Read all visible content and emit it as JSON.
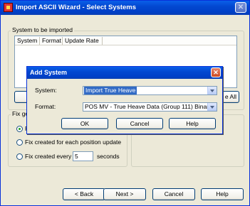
{
  "window": {
    "title": "Import ASCII Wizard - Select Systems"
  },
  "systems_group": {
    "label": "System to be imported",
    "columns": [
      "System",
      "Format",
      "Update Rate"
    ],
    "remove_all_label_fragment": "e All"
  },
  "fix_group": {
    "label_fragment": "Fix ge",
    "options": [
      {
        "label": "F",
        "selected": true
      },
      {
        "label": "Fix created for each position update",
        "selected": false
      },
      {
        "label": "Fix created every",
        "selected": false
      }
    ],
    "interval_value": "5",
    "interval_unit": "seconds"
  },
  "nav_buttons": {
    "back": "< Back",
    "next": "Next >",
    "cancel": "Cancel",
    "help": "Help"
  },
  "dialog": {
    "title": "Add System",
    "system_label": "System:",
    "system_value": "Import True Heave",
    "format_label": "Format:",
    "format_value": "POS MV - True Heave Data (Group 111) Binary",
    "ok": "OK",
    "cancel": "Cancel",
    "help": "Help"
  },
  "colors": {
    "titlebar": "#0040c8",
    "window_bg": "#ece9d8",
    "selection": "#316ac5"
  }
}
